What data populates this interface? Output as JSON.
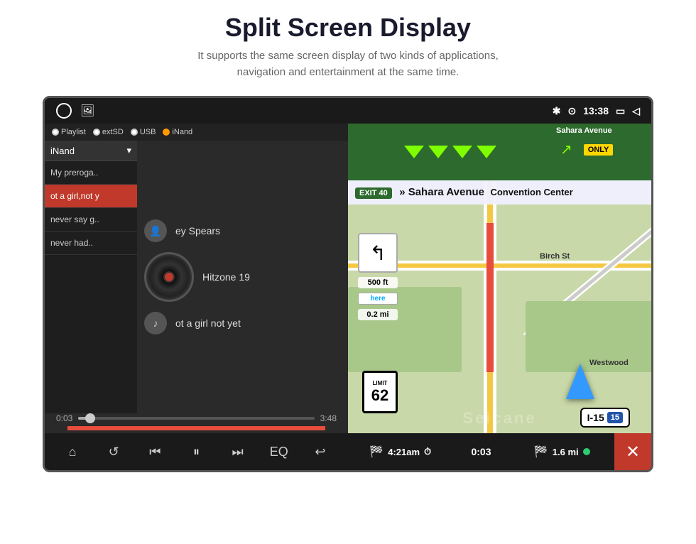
{
  "header": {
    "title": "Split Screen Display",
    "subtitle_line1": "It supports the same screen display of two kinds of applications,",
    "subtitle_line2": "navigation and entertainment at the same time."
  },
  "status_bar": {
    "time": "13:38",
    "bluetooth": "✱",
    "location": "⊕"
  },
  "music": {
    "source_selector": "iNand",
    "sources": [
      "Playlist",
      "extSD",
      "USB",
      "iNand"
    ],
    "playlist": [
      {
        "label": "My preroga..",
        "active": false
      },
      {
        "label": "ot a girl,not y",
        "active": true
      },
      {
        "label": "never say g..",
        "active": false
      },
      {
        "label": "never had..",
        "active": false
      }
    ],
    "artist": "ey Spears",
    "album": "Hitzone 19",
    "track": "ot a girl not yet",
    "time_current": "0:03",
    "time_total": "3:48",
    "controls": {
      "home": "⌂",
      "repeat": "↺",
      "prev": "⏮",
      "play_pause": "⏸",
      "next": "⏭",
      "eq": "EQ",
      "back": "↩"
    }
  },
  "navigation": {
    "exit_number": "EXIT 40",
    "exit_text": "» Sahara Avenue",
    "exit_subtitle": "Convention Center",
    "street_top": "Sahara Avenue",
    "only_text": "ONLY",
    "distance_ft": "500 ft",
    "distance_mi": "0.2 mi",
    "speed_limit": "62",
    "speed_limit_label": "LIMIT",
    "highway": "I-15",
    "route_number": "15",
    "bottom": {
      "time_eta": "4:21am",
      "time_elapsed": "0:03",
      "distance_remain": "1.6 mi"
    },
    "close_label": "✕"
  },
  "watermark": "Seicane"
}
